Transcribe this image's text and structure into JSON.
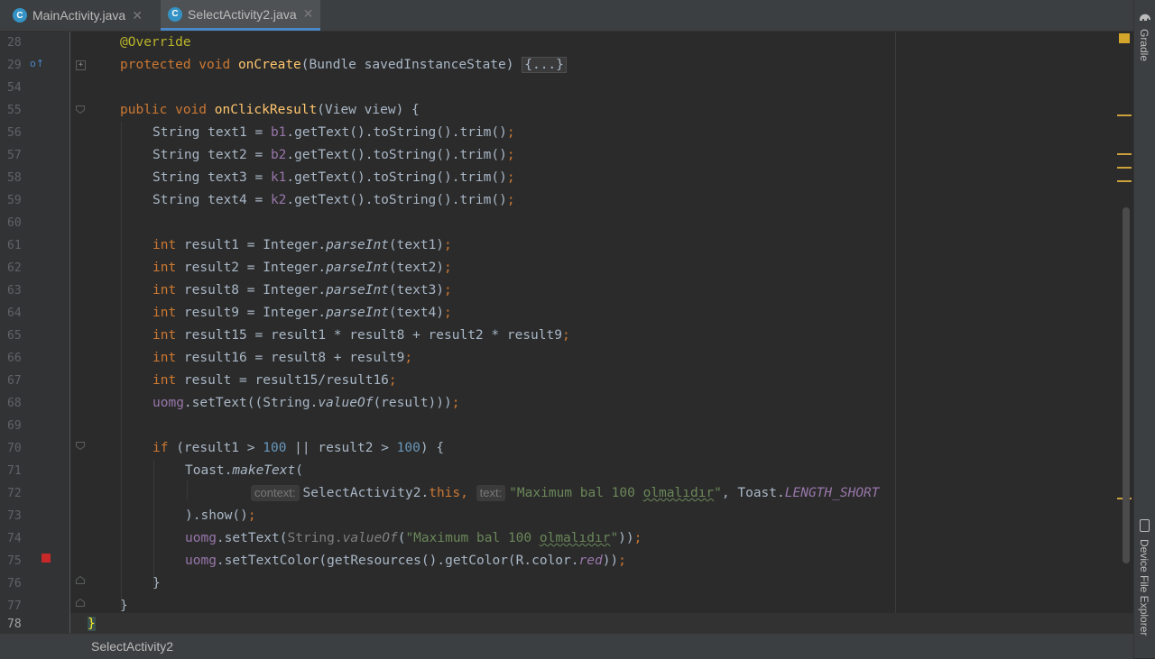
{
  "tabs": [
    {
      "label": "MainActivity.java",
      "icon": "class-c-icon",
      "active": false
    },
    {
      "label": "SelectActivity2.java",
      "icon": "class-c-icon",
      "active": true
    }
  ],
  "gutter": {
    "line_numbers": [
      "28",
      "29",
      "54",
      "55",
      "56",
      "57",
      "58",
      "59",
      "60",
      "61",
      "62",
      "63",
      "64",
      "65",
      "66",
      "67",
      "68",
      "69",
      "70",
      "71",
      "72",
      "73",
      "74",
      "75",
      "76",
      "77",
      "78"
    ]
  },
  "code": {
    "l28": {
      "annotation": "@Override"
    },
    "l29": {
      "kw": "protected void ",
      "fn": "onCreate",
      "rest": "(Bundle savedInstanceState) ",
      "folded": "{...}"
    },
    "l55": {
      "kw": "public void ",
      "fn": "onClickResult",
      "rest": "(View view) {"
    },
    "l56": {
      "a": "String text1 = ",
      "fld": "b1",
      "b": ".getText().toString().trim()",
      "semi": ";"
    },
    "l57": {
      "a": "String text2 = ",
      "fld": "b2",
      "b": ".getText().toString().trim()",
      "semi": ";"
    },
    "l58": {
      "a": "String text3 = ",
      "fld": "k1",
      "b": ".getText().toString().trim()",
      "semi": ";"
    },
    "l59": {
      "a": "String text4 = ",
      "fld": "k2",
      "b": ".getText().toString().trim()",
      "semi": ";"
    },
    "l61": {
      "kw": "int",
      "a": " result1 = Integer.",
      "it": "parseInt",
      "b": "(text1)",
      "semi": ";"
    },
    "l62": {
      "kw": "int",
      "a": " result2 = Integer.",
      "it": "parseInt",
      "b": "(text2)",
      "semi": ";"
    },
    "l63": {
      "kw": "int",
      "a": " result8 = Integer.",
      "it": "parseInt",
      "b": "(text3)",
      "semi": ";"
    },
    "l64": {
      "kw": "int",
      "a": " result9 = Integer.",
      "it": "parseInt",
      "b": "(text4)",
      "semi": ";"
    },
    "l65": {
      "kw": "int",
      "a": " result15 = result1 * result8 + result2 * result9",
      "semi": ";"
    },
    "l66": {
      "kw": "int",
      "a": " result16 = result8 + result9",
      "semi": ";"
    },
    "l67": {
      "kw": "int",
      "a": " result = result15/result16",
      "semi": ";"
    },
    "l68": {
      "fld": "uomg",
      "a": ".setText((String.",
      "it": "valueOf",
      "b": "(result)))",
      "semi": ";"
    },
    "l70": {
      "kw": "if",
      "a": " (result1 > ",
      "n1": "100",
      "b": " || result2 > ",
      "n2": "100",
      "c": ") {"
    },
    "l71": {
      "a": "Toast.",
      "it": "makeText",
      "b": "("
    },
    "l72": {
      "hint1": "context:",
      "a": "SelectActivity2.",
      "kw": "this",
      "comma": ", ",
      "hint2": "text:",
      "str1": "\"Maximum bal 100 ",
      "sq": "olmalıdır",
      "str2": "\"",
      "b": ", Toast.",
      "const": "LENGTH_SHORT"
    },
    "l73": {
      "a": ").show()",
      "semi": ";"
    },
    "l74": {
      "fld": "uomg",
      "a": ".setText(",
      "grey": "String.",
      "it": "valueOf",
      "b": "(",
      "str1": "\"Maximum bal 100 ",
      "sq": "olmalıdır",
      "str2": "\"",
      "c": "))",
      "semi": ";"
    },
    "l75": {
      "fld": "uomg",
      "a": ".setTextColor(getResources().getColor(R.color.",
      "it": "red",
      "b": "))",
      "semi": ";"
    },
    "l76": {
      "a": "}"
    },
    "l77": {
      "a": "}"
    },
    "l78": {
      "a": "}"
    }
  },
  "rightbar": {
    "gradle": "Gradle",
    "device_explorer": "Device File Explorer"
  },
  "breadcrumb": {
    "label": "SelectActivity2"
  },
  "colors": {
    "keyword": "#cc7832",
    "function": "#ffc66d",
    "field": "#9876aa",
    "string": "#6a8759",
    "number": "#6897bb",
    "annotation": "#bbb529"
  }
}
